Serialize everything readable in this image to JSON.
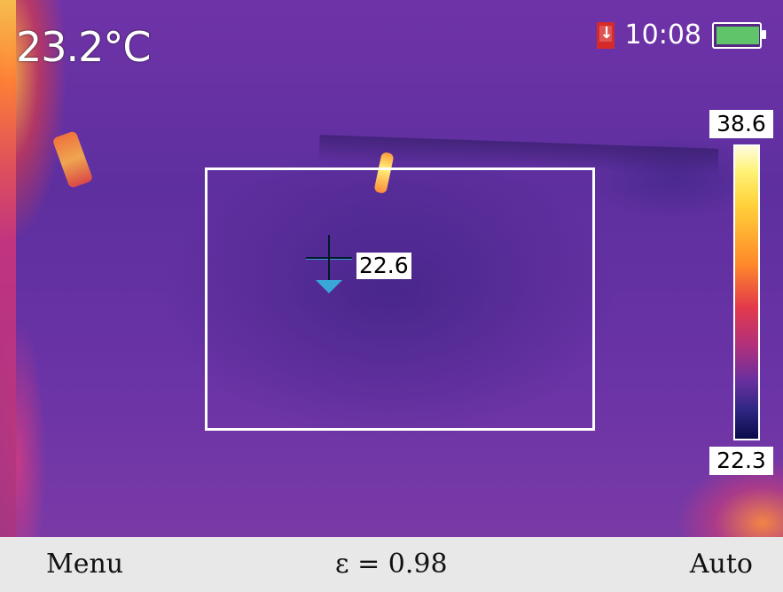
{
  "header": {
    "center_temp": "23.2°C",
    "time": "10:08",
    "sd_icon": "sd-card-record-icon",
    "battery_icon": "battery-full-icon",
    "battery_level": 0.92
  },
  "measurement": {
    "spot_value": "22.6",
    "crosshair_icon": "crosshair-icon",
    "min_marker_icon": "min-temp-marker-icon"
  },
  "scale": {
    "max": "38.6",
    "min": "22.3",
    "palette": "iron"
  },
  "softkeys": {
    "left": "Menu",
    "center": "ε = 0.98",
    "right": "Auto"
  },
  "colors": {
    "roi_border": "#ffffff",
    "battery_fill": "#5fc46a",
    "sd_icon": "#d62a2a",
    "marker": "#3aa7d9",
    "softkey_bar": "#e8e8e8"
  }
}
